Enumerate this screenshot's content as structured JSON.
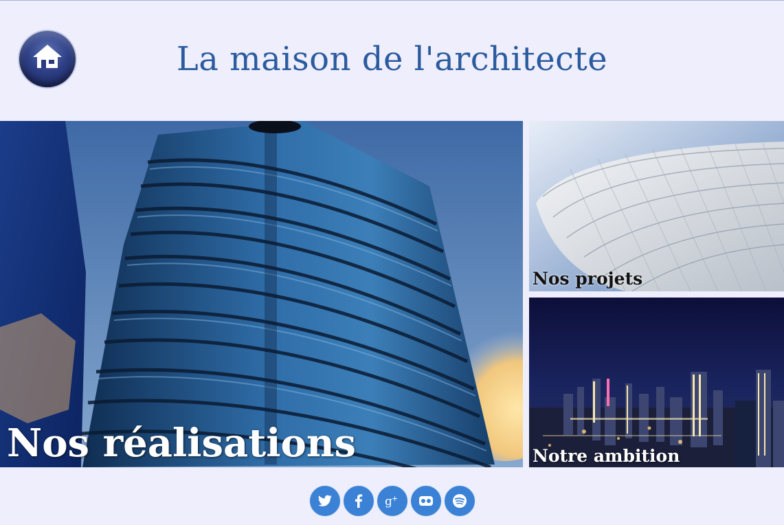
{
  "header": {
    "title": "La maison de l'architecte",
    "home_icon": "home-icon"
  },
  "tiles": {
    "main": {
      "label": "Nos réalisations"
    },
    "projets": {
      "label": "Nos projets"
    },
    "ambition": {
      "label": "Notre ambition"
    }
  },
  "social": [
    {
      "name": "twitter",
      "icon": "twitter-icon"
    },
    {
      "name": "facebook",
      "icon": "facebook-icon"
    },
    {
      "name": "google-plus",
      "icon": "google-plus-icon"
    },
    {
      "name": "flickr",
      "icon": "flickr-icon"
    },
    {
      "name": "spotify",
      "icon": "spotify-icon"
    }
  ],
  "colors": {
    "background": "#eeeefc",
    "title": "#2b5b9e",
    "social_button": "#3b82d6"
  }
}
